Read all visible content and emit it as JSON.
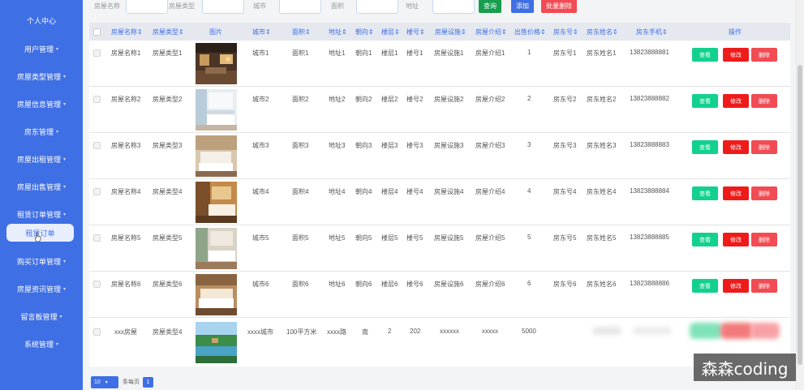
{
  "sidebar": {
    "items": [
      {
        "label": "个人中心"
      },
      {
        "label": "用户管理"
      },
      {
        "label": "房屋类型管理"
      },
      {
        "label": "房屋信息管理"
      },
      {
        "label": "房东管理"
      },
      {
        "label": "房屋出租管理"
      },
      {
        "label": "房屋出售管理"
      },
      {
        "label": "租赁订单管理"
      },
      {
        "label": "购买订单管理"
      },
      {
        "label": "房屋资讯管理"
      },
      {
        "label": "留言板管理"
      },
      {
        "label": "系统管理"
      }
    ],
    "submenu_active": "租赁订单",
    "chevron": "▾",
    "colors": {
      "bg": "#3f6fe4",
      "active_bg": "#e9eefc"
    }
  },
  "search": {
    "fields": [
      {
        "label": "房屋名称",
        "value": ""
      },
      {
        "label": "房屋类型",
        "value": ""
      },
      {
        "label": "城市",
        "value": ""
      },
      {
        "label": "面积",
        "value": ""
      },
      {
        "label": "地址",
        "value": ""
      }
    ],
    "query_button": "查询",
    "add_button": "添加",
    "batch_delete_button": "批量删除"
  },
  "table": {
    "headers": [
      "房屋名称",
      "房屋类型",
      "图片",
      "城市",
      "面积",
      "地址",
      "朝向",
      "楼层",
      "楼号",
      "房屋设施",
      "房屋介绍",
      "出售价格",
      "房东号",
      "房东姓名",
      "房东手机",
      "操作"
    ],
    "sort_indicator": "⇕",
    "actions": {
      "view": "查看",
      "edit": "修改",
      "delete": "删除"
    },
    "rows": [
      {
        "name": "房屋名称1",
        "type": "房屋类型1",
        "city": "城市1",
        "area": "面积1",
        "address": "地址1",
        "orientation": "朝向1",
        "floor": "楼层1",
        "building": "楼号1",
        "facility": "房屋设施1",
        "intro": "房屋介绍1",
        "price": "1",
        "landlord_no": "房东号1",
        "landlord_name": "房东姓名1",
        "phone": "13823888881"
      },
      {
        "name": "房屋名称2",
        "type": "房屋类型2",
        "city": "城市2",
        "area": "面积2",
        "address": "地址2",
        "orientation": "朝向2",
        "floor": "楼层2",
        "building": "楼号2",
        "facility": "房屋设施2",
        "intro": "房屋介绍2",
        "price": "2",
        "landlord_no": "房东号2",
        "landlord_name": "房东姓名2",
        "phone": "13823888882"
      },
      {
        "name": "房屋名称3",
        "type": "房屋类型3",
        "city": "城市3",
        "area": "面积3",
        "address": "地址3",
        "orientation": "朝向3",
        "floor": "楼层3",
        "building": "楼号3",
        "facility": "房屋设施3",
        "intro": "房屋介绍3",
        "price": "3",
        "landlord_no": "房东号3",
        "landlord_name": "房东姓名3",
        "phone": "13823888883"
      },
      {
        "name": "房屋名称4",
        "type": "房屋类型4",
        "city": "城市4",
        "area": "面积4",
        "address": "地址4",
        "orientation": "朝向4",
        "floor": "楼层4",
        "building": "楼号4",
        "facility": "房屋设施4",
        "intro": "房屋介绍4",
        "price": "4",
        "landlord_no": "房东号4",
        "landlord_name": "房东姓名4",
        "phone": "13823888884"
      },
      {
        "name": "房屋名称5",
        "type": "房屋类型5",
        "city": "城市5",
        "area": "面积5",
        "address": "地址5",
        "orientation": "朝向5",
        "floor": "楼层5",
        "building": "楼号5",
        "facility": "房屋设施5",
        "intro": "房屋介绍5",
        "price": "5",
        "landlord_no": "房东号5",
        "landlord_name": "房东姓名5",
        "phone": "13823888885"
      },
      {
        "name": "房屋名称6",
        "type": "房屋类型6",
        "city": "城市6",
        "area": "面积6",
        "address": "地址6",
        "orientation": "朝向6",
        "floor": "楼层6",
        "building": "楼号6",
        "facility": "房屋设施6",
        "intro": "房屋介绍6",
        "price": "6",
        "landlord_no": "房东号6",
        "landlord_name": "房东姓名6",
        "phone": "13823888886"
      },
      {
        "name": "xxx房屋",
        "type": "房屋类型4",
        "city": "xxxx城市",
        "area": "100平方米",
        "address": "xxxx路",
        "orientation": "南",
        "floor": "2",
        "building": "202",
        "facility": "xxxxxx",
        "intro": "xxxxx",
        "price": "5000",
        "landlord_no": "",
        "landlord_name": "",
        "phone": ""
      }
    ]
  },
  "pagination": {
    "page_size": "10",
    "page_size_suffix": "条每页",
    "current_page": "1"
  },
  "watermark": "森森coding",
  "colors": {
    "primary": "#3f6fe4",
    "query": "#189d4e",
    "add": "#3f6fe4",
    "batch_delete": "#f14b53",
    "view": "#12d18e",
    "edit": "#ee1b1b",
    "delete": "#f14b53"
  }
}
